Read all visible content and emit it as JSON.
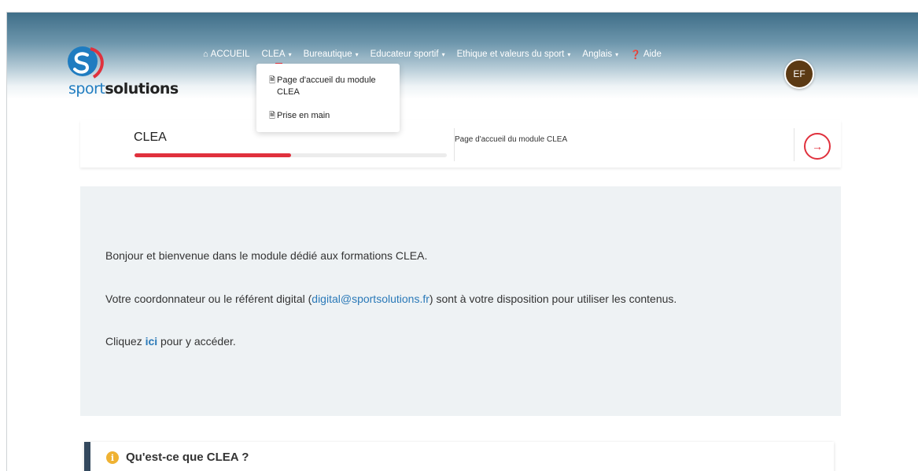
{
  "brand": {
    "name_part1": "sport",
    "name_part2": "solutions"
  },
  "nav": {
    "items": [
      {
        "label": "ACCUEIL",
        "icon": "home-icon",
        "caret": false
      },
      {
        "label": "CLEA",
        "icon": null,
        "caret": true,
        "active": true
      },
      {
        "label": "Bureautique",
        "icon": null,
        "caret": true
      },
      {
        "label": "Educateur sportif",
        "icon": null,
        "caret": true
      },
      {
        "label": "Ethique et valeurs du sport",
        "icon": null,
        "caret": true
      },
      {
        "label": "Anglais",
        "icon": null,
        "caret": true
      },
      {
        "label": "Aide",
        "icon": "question-circle-icon",
        "caret": false
      }
    ]
  },
  "user": {
    "initials": "EF"
  },
  "dropdown": {
    "items": [
      {
        "label": "Page d'accueil du module CLEA"
      },
      {
        "label": "Prise en main"
      }
    ]
  },
  "module": {
    "title": "CLEA",
    "current_page": "Page d'accueil du module CLEA",
    "progress": 0.5
  },
  "content": {
    "p1": "Bonjour et bienvenue dans le module dédié aux formations CLEA.",
    "p2_before": "Votre coordonnateur ou le référent digital (",
    "p2_link": "digital@sportsolutions.fr",
    "p2_after": ") sont à votre disposition pour utiliser les contenus.",
    "p3_before": "Cliquez ",
    "p3_link": "ici",
    "p3_after": " pour y accéder."
  },
  "faq": {
    "title": "Qu'est-ce que CLEA ?"
  },
  "colors": {
    "accent": "#e0313d",
    "link": "#2a79b8",
    "avatar": "#5c3a14",
    "info": "#efb233"
  }
}
